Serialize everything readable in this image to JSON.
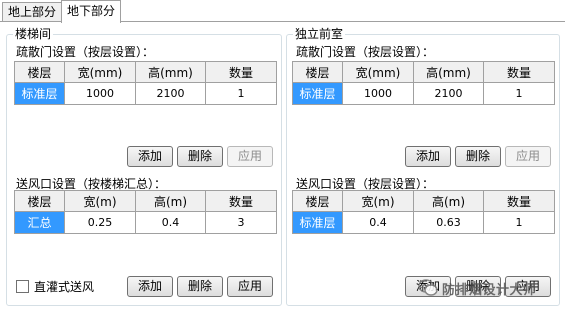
{
  "tabs": [
    {
      "label": "地上部分",
      "active": false
    },
    {
      "label": "地下部分",
      "active": true
    }
  ],
  "stair": {
    "group_title": "楼梯间",
    "door_label": "疏散门设置（按层设置）：",
    "door_headers": [
      "楼层",
      "宽(mm)",
      "高(mm)",
      "数量"
    ],
    "door_row": [
      "标准层",
      "1000",
      "2100",
      "1"
    ],
    "door_buttons": [
      "添加",
      "删除",
      "应用"
    ],
    "vent_label": "送风口设置（按楼梯汇总）：",
    "vent_headers": [
      "楼层",
      "宽(m)",
      "高(m)",
      "数量"
    ],
    "vent_row": [
      "汇总",
      "0.25",
      "0.4",
      "3"
    ],
    "direct_label": "直灌式送风",
    "vent_buttons": [
      "添加",
      "删除",
      "应用"
    ]
  },
  "front": {
    "group_title": "独立前室",
    "door_label": "疏散门设置（按层设置）：",
    "door_headers": [
      "楼层",
      "宽(mm)",
      "高(mm)",
      "数量"
    ],
    "door_row": [
      "标准层",
      "1000",
      "2100",
      "1"
    ],
    "door_buttons": [
      "添加",
      "删除",
      "应用"
    ],
    "vent_label": "送风口设置（按层设置）：",
    "vent_headers": [
      "楼层",
      "宽(m)",
      "高(m)",
      "数量"
    ],
    "vent_row": [
      "标准层",
      "0.4",
      "0.63",
      "1"
    ],
    "vent_buttons": [
      "添加",
      "删除",
      "应用"
    ]
  },
  "watermark": {
    "text": "防排烟设计大师"
  },
  "colors": {
    "selection": "#3399ff",
    "header_bg": "#f0f0f0",
    "border": "#a0a0a0"
  }
}
